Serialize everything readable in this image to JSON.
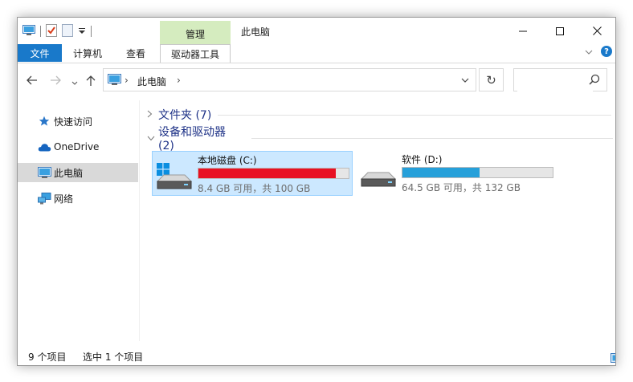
{
  "title_bar": {
    "context_group_label": "管理",
    "window_title": "此电脑"
  },
  "ribbon": {
    "tabs": [
      {
        "label": "文件"
      },
      {
        "label": "计算机"
      },
      {
        "label": "查看"
      },
      {
        "label": "驱动器工具"
      }
    ]
  },
  "address_bar": {
    "breadcrumb": "此电脑",
    "search_placeholder": ""
  },
  "sidebar": {
    "items": [
      {
        "label": "快速访问",
        "icon": "pin-star-icon"
      },
      {
        "label": "OneDrive",
        "icon": "cloud-icon"
      },
      {
        "label": "此电脑",
        "icon": "computer-icon",
        "selected": true
      },
      {
        "label": "网络",
        "icon": "network-icon"
      }
    ]
  },
  "content": {
    "groups": [
      {
        "label": "文件夹 (7)",
        "expanded": false
      },
      {
        "label": "设备和驱动器 (2)",
        "expanded": true
      }
    ],
    "drives": [
      {
        "name": "本地磁盘 (C:)",
        "space": "8.4 GB 可用，共 100 GB",
        "used_fraction": 0.916,
        "bar_color": "#e81123",
        "selected": true
      },
      {
        "name": "软件 (D:)",
        "space": "64.5 GB 可用，共 132 GB",
        "used_fraction": 0.511,
        "bar_color": "#26a0da",
        "selected": false
      }
    ]
  },
  "status_bar": {
    "item_count": "9 个项目",
    "selection": "选中 1 个项目"
  },
  "colors": {
    "accent": "#1979ca",
    "context_tab": "#d5ecbf",
    "selection": "#cce8ff"
  }
}
